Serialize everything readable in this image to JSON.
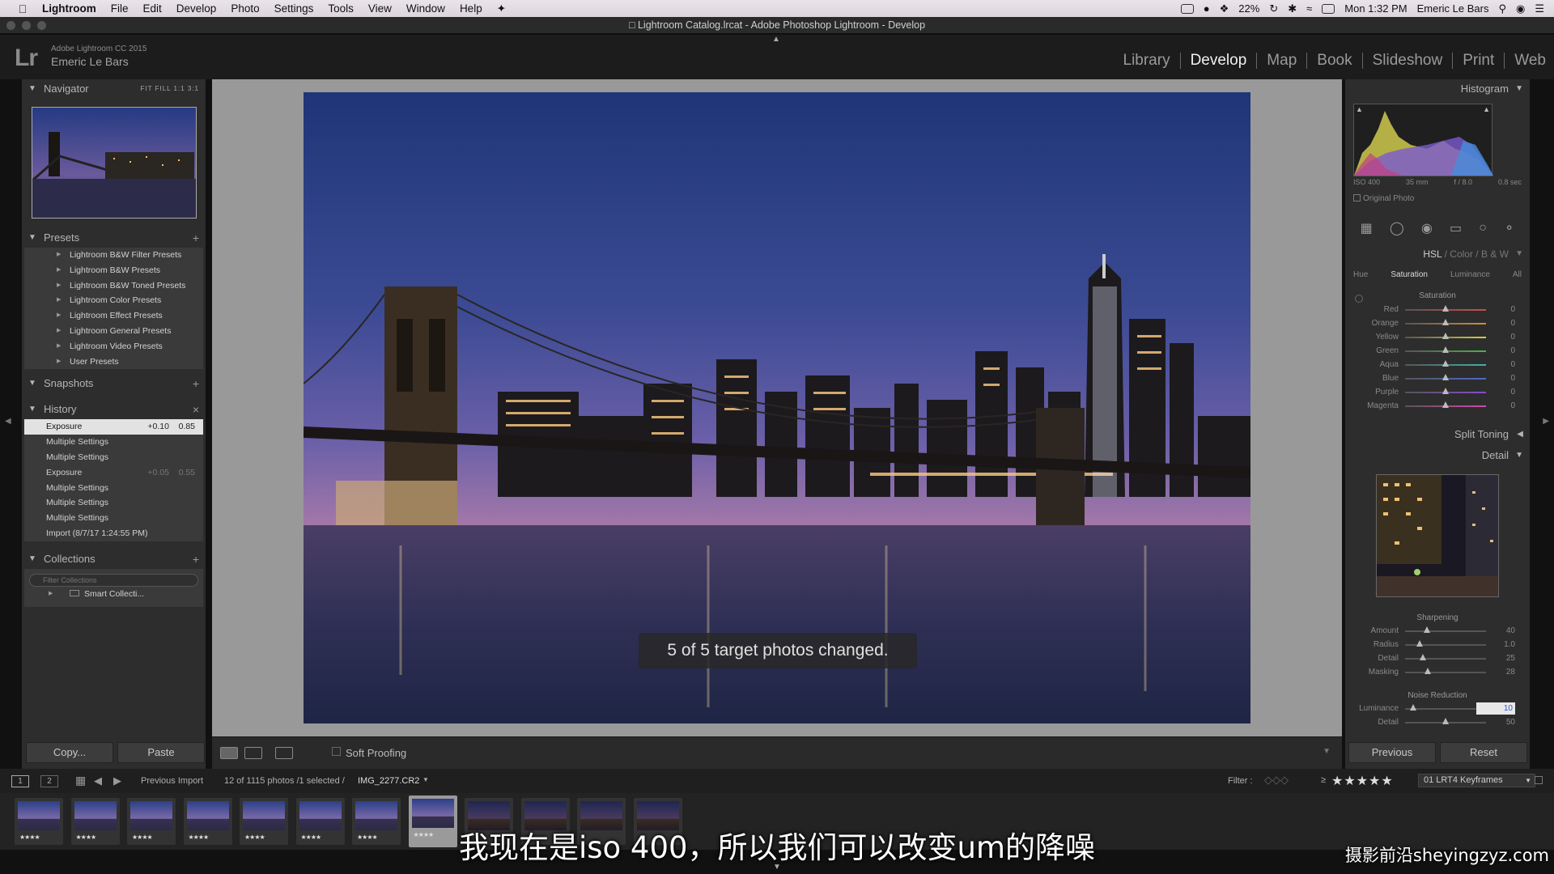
{
  "menubar": {
    "app": "Lightroom",
    "items": [
      "File",
      "Edit",
      "Develop",
      "Photo",
      "Settings",
      "Tools",
      "View",
      "Window",
      "Help"
    ],
    "battery": "22%",
    "clock": "Mon 1:32 PM",
    "user": "Emeric Le Bars"
  },
  "window": {
    "title": "Lightroom Catalog.lrcat - Adobe Photoshop Lightroom - Develop"
  },
  "identity": {
    "logo": "Lr",
    "version": "Adobe Lightroom CC 2015",
    "user": "Emeric Le Bars"
  },
  "modules": [
    "Library",
    "Develop",
    "Map",
    "Book",
    "Slideshow",
    "Print",
    "Web"
  ],
  "active_module": "Develop",
  "left": {
    "navigator": {
      "title": "Navigator",
      "options": "FIT  FILL  1:1  3:1"
    },
    "presets": {
      "title": "Presets",
      "items": [
        "Lightroom B&W Filter Presets",
        "Lightroom B&W Presets",
        "Lightroom B&W Toned Presets",
        "Lightroom Color Presets",
        "Lightroom Effect Presets",
        "Lightroom General Presets",
        "Lightroom Video Presets",
        "User Presets"
      ]
    },
    "snapshots": {
      "title": "Snapshots"
    },
    "history": {
      "title": "History",
      "items": [
        {
          "label": "Exposure",
          "v1": "+0.10",
          "v2": "0.85",
          "selected": true
        },
        {
          "label": "Multiple Settings",
          "v1": "",
          "v2": ""
        },
        {
          "label": "Multiple Settings",
          "v1": "",
          "v2": ""
        },
        {
          "label": "Exposure",
          "v1": "+0.05",
          "v2": "0.55"
        },
        {
          "label": "Multiple Settings",
          "v1": "",
          "v2": ""
        },
        {
          "label": "Multiple Settings",
          "v1": "",
          "v2": ""
        },
        {
          "label": "Multiple Settings",
          "v1": "",
          "v2": ""
        },
        {
          "label": "Import (8/7/17 1:24:55 PM)",
          "v1": "",
          "v2": ""
        }
      ]
    },
    "collections": {
      "title": "Collections",
      "filter_placeholder": "Filter Collections",
      "items": [
        "Smart Collecti..."
      ]
    },
    "copy_label": "Copy...",
    "paste_label": "Paste"
  },
  "toolbar": {
    "soft_proofing": "Soft Proofing"
  },
  "toast": "5 of 5 target photos changed.",
  "right": {
    "histogram": {
      "title": "Histogram",
      "iso": "ISO 400",
      "focal": "35 mm",
      "aperture": "f / 8.0",
      "shutter": "0.8 sec",
      "original": "Original Photo"
    },
    "hsl": {
      "title_parts": [
        "HSL",
        "Color",
        "B & W"
      ],
      "tabs": [
        "Hue",
        "Saturation",
        "Luminance",
        "All"
      ],
      "active_tab": "Saturation",
      "section": "Saturation",
      "rows": [
        {
          "label": "Red",
          "value": "0",
          "pos": 0.5,
          "color": "#d04a4a"
        },
        {
          "label": "Orange",
          "value": "0",
          "pos": 0.5,
          "color": "#d98a3a"
        },
        {
          "label": "Yellow",
          "value": "0",
          "pos": 0.5,
          "color": "#d8cf3a"
        },
        {
          "label": "Green",
          "value": "0",
          "pos": 0.5,
          "color": "#4fb04f"
        },
        {
          "label": "Aqua",
          "value": "0",
          "pos": 0.5,
          "color": "#40b0b0"
        },
        {
          "label": "Blue",
          "value": "0",
          "pos": 0.5,
          "color": "#4a6ad0"
        },
        {
          "label": "Purple",
          "value": "0",
          "pos": 0.5,
          "color": "#8a4ad0"
        },
        {
          "label": "Magenta",
          "value": "0",
          "pos": 0.5,
          "color": "#d04ab0"
        }
      ]
    },
    "split_toning": {
      "title": "Split Toning"
    },
    "detail": {
      "title": "Detail",
      "sharpening": {
        "title": "Sharpening",
        "rows": [
          {
            "label": "Amount",
            "value": "40",
            "pos": 0.27
          },
          {
            "label": "Radius",
            "value": "1.0",
            "pos": 0.18
          },
          {
            "label": "Detail",
            "value": "25",
            "pos": 0.22
          },
          {
            "label": "Masking",
            "value": "28",
            "pos": 0.28
          }
        ]
      },
      "noise": {
        "title": "Noise Reduction",
        "rows": [
          {
            "label": "Luminance",
            "value": "10",
            "pos": 0.1
          },
          {
            "label": "Detail",
            "value": "50",
            "pos": 0.5
          }
        ]
      }
    },
    "previous_label": "Previous",
    "reset_label": "Reset"
  },
  "filmbar": {
    "screens": [
      "1",
      "2"
    ],
    "source": "Previous Import",
    "count": "12 of 1115 photos /1 selected /",
    "filename": "IMG_2277.CR2",
    "filter_label": "Filter :",
    "stars": "★★★★★",
    "preset": "01 LRT4 Keyframes"
  },
  "filmstrip": {
    "count": 12,
    "selected_index": 7,
    "stars": "★★★★"
  },
  "subtitle": "我现在是iso 400，所以我们可以改变um的降噪",
  "watermark": "摄影前沿sheyingzyz.com"
}
